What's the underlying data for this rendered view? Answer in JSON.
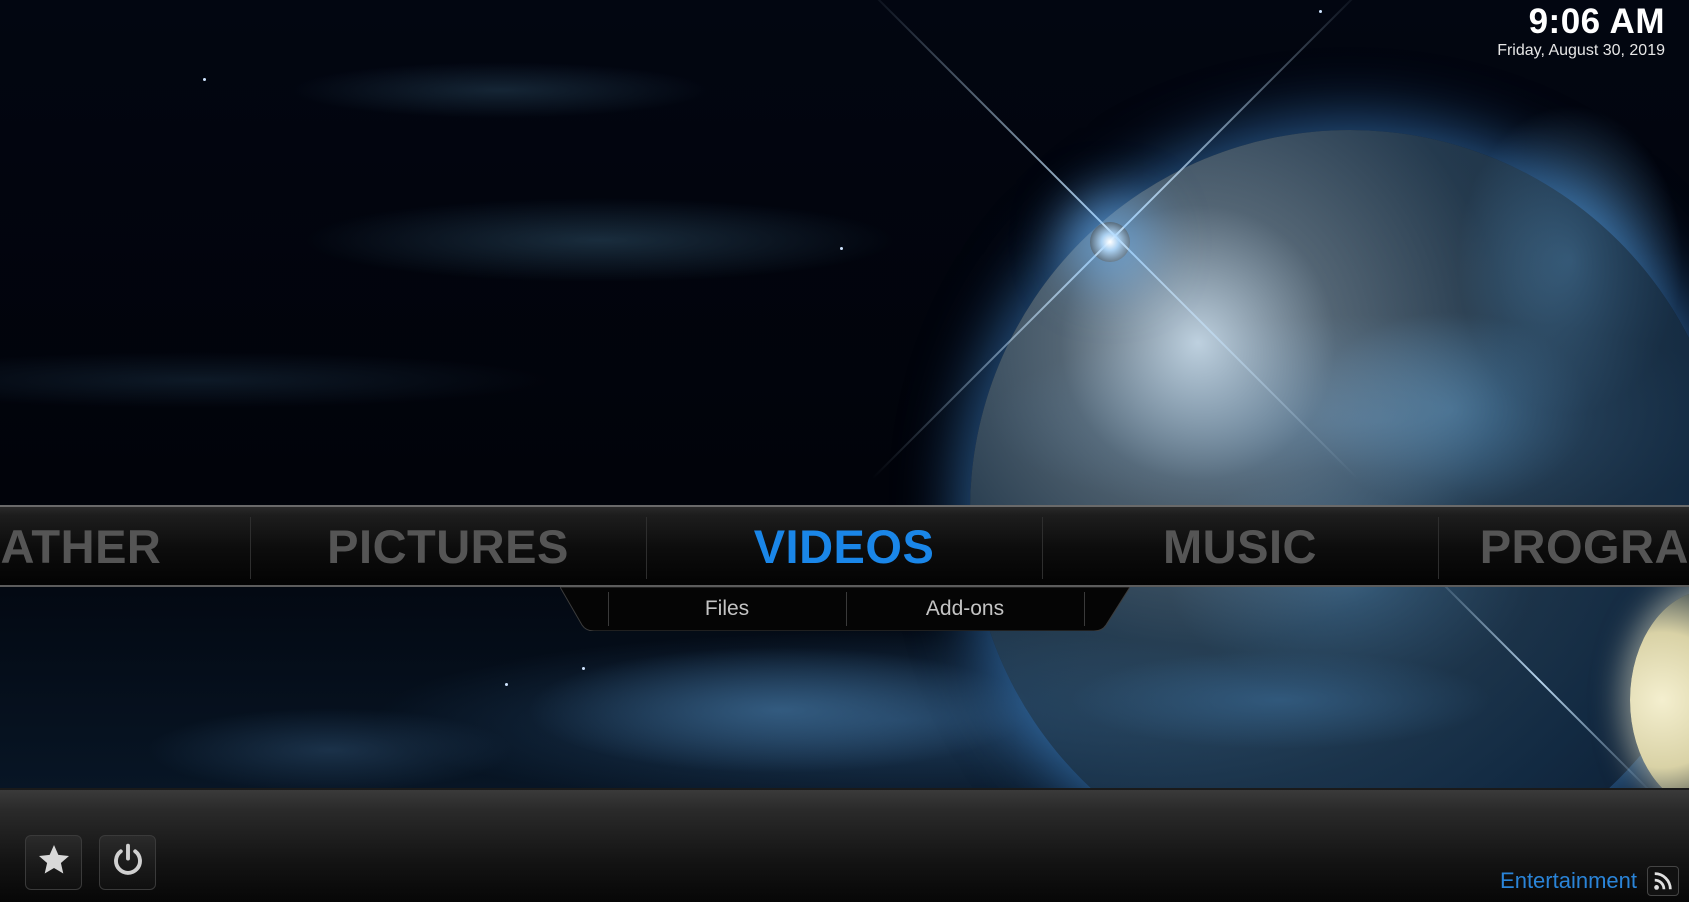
{
  "clock": {
    "time": "9:06 AM",
    "date": "Friday, August 30, 2019"
  },
  "main_menu": {
    "items": [
      {
        "label": "WEATHER",
        "visible_text": "EATHER",
        "active": false
      },
      {
        "label": "PICTURES",
        "visible_text": "PICTURES",
        "active": false
      },
      {
        "label": "VIDEOS",
        "visible_text": "VIDEOS",
        "active": true
      },
      {
        "label": "MUSIC",
        "visible_text": "MUSIC",
        "active": false
      },
      {
        "label": "PROGRAMS",
        "visible_text": "PROGRA",
        "active": false
      }
    ],
    "active_color": "#1a86e8",
    "inactive_color": "#555555"
  },
  "submenu": {
    "items": [
      {
        "label": "Files"
      },
      {
        "label": "Add-ons"
      }
    ]
  },
  "bottom_bar": {
    "buttons": [
      {
        "icon": "star-icon",
        "label": "Favourites"
      },
      {
        "icon": "power-icon",
        "label": "Power"
      }
    ],
    "feed": {
      "label": "Entertainment",
      "icon": "rss-icon",
      "color": "#2a84d8"
    }
  }
}
